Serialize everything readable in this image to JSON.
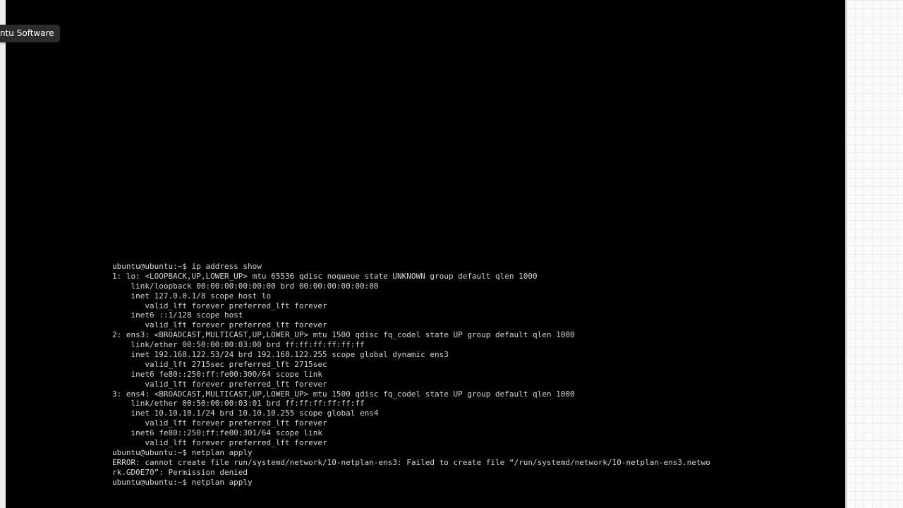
{
  "tooltip": {
    "text": "ntu Software"
  },
  "terminal": {
    "lines": [
      "ubuntu@ubuntu:~$ ip address show",
      "1: lo: <LOOPBACK,UP,LOWER_UP> mtu 65536 qdisc noqueue state UNKNOWN group default qlen 1000",
      "    link/loopback 00:00:00:00:00:00 brd 00:00:00:00:00:00",
      "    inet 127.0.0.1/8 scope host lo",
      "       valid_lft forever preferred_lft forever",
      "    inet6 ::1/128 scope host",
      "       valid_lft forever preferred_lft forever",
      "2: ens3: <BROADCAST,MULTICAST,UP,LOWER_UP> mtu 1500 qdisc fq_codel state UP group default qlen 1000",
      "    link/ether 00:50:00:00:03:00 brd ff:ff:ff:ff:ff:ff",
      "    inet 192.168.122.53/24 brd 192.168.122.255 scope global dynamic ens3",
      "       valid_lft 2715sec preferred_lft 2715sec",
      "    inet6 fe80::250:ff:fe00:300/64 scope link",
      "       valid_lft forever preferred_lft forever",
      "3: ens4: <BROADCAST,MULTICAST,UP,LOWER_UP> mtu 1500 qdisc fq_codel state UP group default qlen 1000",
      "    link/ether 00:50:00:00:03:01 brd ff:ff:ff:ff:ff:ff",
      "    inet 10.10.10.1/24 brd 10.10.10.255 scope global ens4",
      "       valid_lft forever preferred_lft forever",
      "    inet6 fe80::250:ff:fe00:301/64 scope link",
      "       valid_lft forever preferred_lft forever",
      "ubuntu@ubuntu:~$ netplan apply",
      "ERROR: cannot create file run/systemd/network/10-netplan-ens3: Failed to create file “/run/systemd/network/10-netplan-ens3.netwo",
      "rk.GD0E70”: Permission denied",
      "ubuntu@ubuntu:~$ netplan apply"
    ]
  }
}
